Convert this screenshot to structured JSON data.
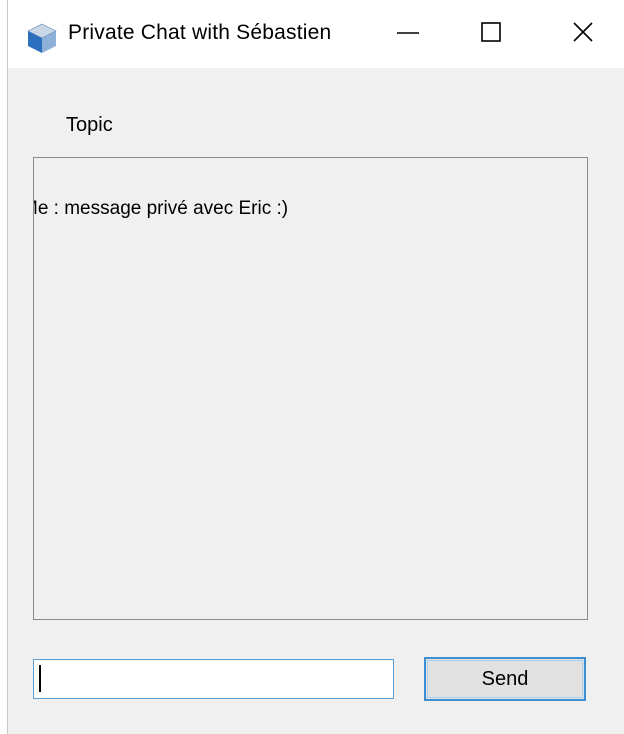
{
  "window": {
    "title": "Private Chat with Sébastien",
    "icon": "app-cube-icon",
    "controls": {
      "minimize": "minimize-icon",
      "maximize": "maximize-icon",
      "close": "close-icon"
    }
  },
  "topic": {
    "label": "Topic"
  },
  "chat": {
    "messages": [
      {
        "text": "Me : message privé avec Eric :)"
      }
    ]
  },
  "composer": {
    "value": "",
    "send_label": "Send"
  },
  "colors": {
    "window_bg": "#f0f0f0",
    "titlebar_bg": "#ffffff",
    "focus_border": "#3c8fd3",
    "button_bg": "#e1e1e1"
  }
}
